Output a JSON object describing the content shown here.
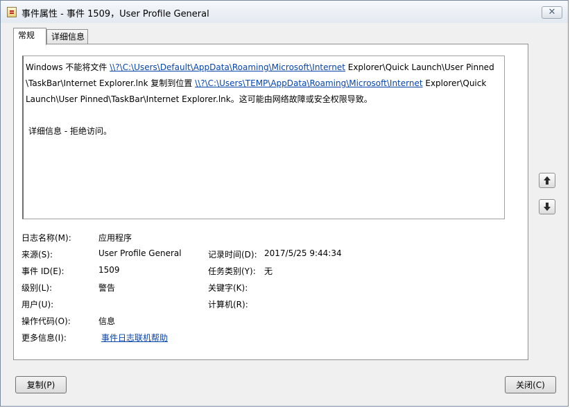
{
  "window": {
    "title": "事件属性 - 事件 1509，User Profile General",
    "close_glyph": "✕"
  },
  "tabs": [
    {
      "label": "常规",
      "active": true
    },
    {
      "label": "详细信息",
      "active": false
    }
  ],
  "message": {
    "line1_prefix": "Windows 不能将文件 ",
    "line1_link": "\\\\?\\C:\\Users\\Default\\AppData\\Roaming\\Microsoft\\Internet",
    "line1_suffix": " Explorer\\Quick Launch\\User Pinned",
    "line2_prefix": "\\TaskBar\\Internet Explorer.lnk 复制到位置 ",
    "line2_link": "\\\\?\\C:\\Users\\TEMP\\AppData\\Roaming\\Microsoft\\Internet",
    "line2_suffix": " Explorer\\Quick",
    "line3": "Launch\\User Pinned\\TaskBar\\Internet Explorer.lnk。这可能由网络故障或安全权限导致。",
    "detail": "详细信息 - 拒绝访问。"
  },
  "properties": {
    "log_name_label": "日志名称(M):",
    "log_name_value": "应用程序",
    "source_label": "来源(S):",
    "source_value": "User Profile General",
    "logged_label": "记录时间(D):",
    "logged_value": "2017/5/25 9:44:34",
    "event_id_label": "事件 ID(E):",
    "event_id_value": "1509",
    "task_category_label": "任务类别(Y):",
    "task_category_value": "无",
    "level_label": "级别(L):",
    "level_value": "警告",
    "keywords_label": "关键字(K):",
    "user_label": "用户(U):",
    "computer_label": "计算机(R):",
    "opcode_label": "操作代码(O):",
    "opcode_value": "信息",
    "more_info_label": "更多信息(I):",
    "more_info_link": "事件日志联机帮助"
  },
  "buttons": {
    "copy": "复制(P)",
    "close": "关闭(C)"
  },
  "icons": {
    "scroll_up": "arrow-up-icon",
    "scroll_down": "arrow-down-icon"
  }
}
